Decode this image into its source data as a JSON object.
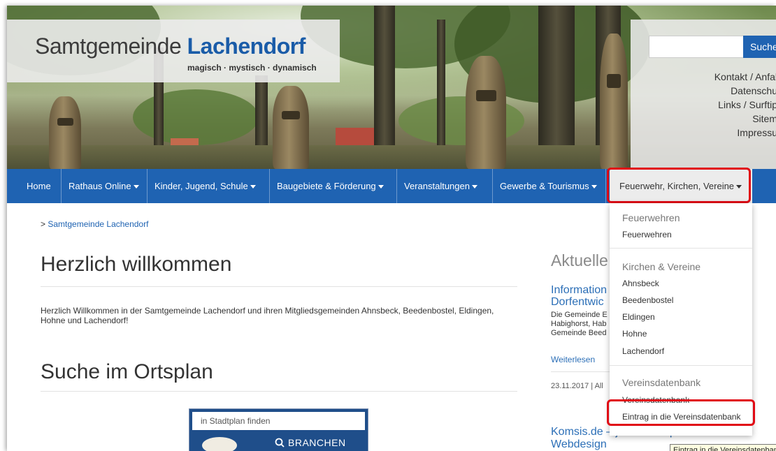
{
  "header": {
    "logo_text_plain": "Samtgemeinde ",
    "logo_text_bold": "Lachendorf",
    "logo_subtitle": "magisch · mystisch · dynamisch",
    "search_button": "Suche",
    "search_value": "",
    "quicklinks": [
      "Kontakt / Anfal",
      "Datenschu",
      "Links / Surftip",
      "Sitem",
      "Impressu"
    ]
  },
  "nav": {
    "items": [
      {
        "label": "Home",
        "caret": false
      },
      {
        "label": "Rathaus Online",
        "caret": true
      },
      {
        "label": "Kinder, Jugend, Schule",
        "caret": true
      },
      {
        "label": "Baugebiete & Förderung",
        "caret": true
      },
      {
        "label": "Veranstaltungen",
        "caret": true
      },
      {
        "label": "Gewerbe & Tourismus",
        "caret": true
      },
      {
        "label": "Feuerwehr, Kirchen, Vereine",
        "caret": true,
        "open": true
      }
    ]
  },
  "breadcrumb": {
    "prefix": "> ",
    "link": "Samtgemeinde Lachendorf"
  },
  "main": {
    "title": "Herzlich willkommen",
    "intro": "Herzlich Willkommen in der Samtgemeinde Lachendorf und ihren Mitgliedsgemeinden Ahnsbeck, Beedenbostel, Eldingen, Hohne und Lachendorf!",
    "map_heading": "Suche im Ortsplan",
    "map_placeholder": "in Stadtplan finden",
    "map_button": "BRANCHEN"
  },
  "sidebar": {
    "heading": "Aktuelle",
    "news1_title_1": "Information",
    "news1_title_2": "Dorfentwic",
    "news1_text_1": "Die Gemeinde E",
    "news1_text_2": "Habighorst, Hab",
    "news1_text_3": "Gemeinde Beed",
    "read_more": "Weiterlesen",
    "date": "23.11.2017 | All",
    "news2_title_1": "Komsis.de – jetzt im responsiven",
    "news2_title_2": "Webdesign"
  },
  "dropdown": {
    "sections": [
      {
        "heading": "Feuerwehren",
        "items": [
          "Feuerwehren"
        ]
      },
      {
        "heading": "Kirchen & Vereine",
        "items": [
          "Ahnsbeck",
          "Beedenbostel",
          "Eldingen",
          "Hohne",
          "Lachendorf"
        ]
      },
      {
        "heading": "Vereinsdatenbank",
        "items": [
          "Vereinsdatenbank",
          "Eintrag in die Vereinsdatenbank"
        ]
      }
    ]
  },
  "tooltip": "Eintrag in die Vereinsdatenbank",
  "colors": {
    "nav_blue": "#1f63b2",
    "link_blue": "#2c6fb7",
    "highlight_red": "#e10a15"
  }
}
